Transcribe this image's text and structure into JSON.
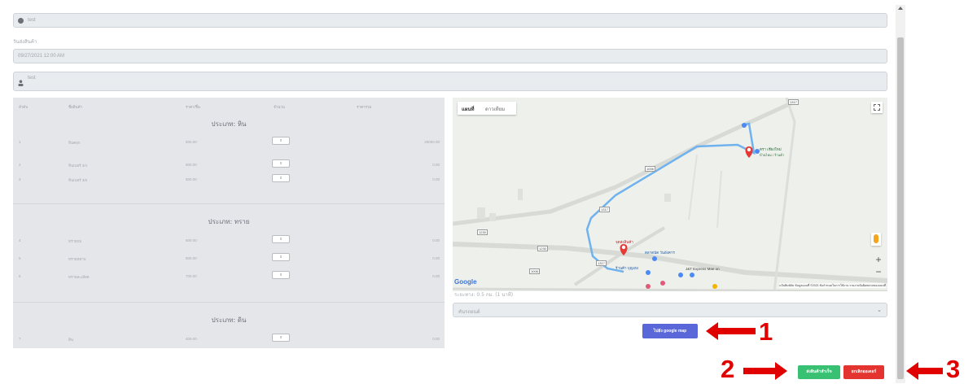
{
  "form": {
    "name_placeholder": "test",
    "date_label": "วันส่งสินค้า",
    "date_value": "09/27/2021 12:00 AM",
    "user_placeholder": "test"
  },
  "table": {
    "headers": [
      "ลำดับ",
      "ชื่อสินค้า",
      "ราคา/ชิ้น",
      "จำนวน",
      "ราคารวม"
    ],
    "sections": [
      {
        "title": "ประเภท: หิน",
        "rows": [
          {
            "no": "1",
            "name": "หินคลุก",
            "price": "500.00",
            "qty": "0",
            "total": "25000.00"
          },
          {
            "no": "2",
            "name": "หินเบอร์ 3/4",
            "price": "600.00",
            "qty": "0",
            "total": "0.00"
          },
          {
            "no": "3",
            "name": "หินเบอร์ 3/8",
            "price": "500.00",
            "qty": "0",
            "total": "0.00"
          }
        ]
      },
      {
        "title": "ประเภท: ทราย",
        "rows": [
          {
            "no": "4",
            "name": "ทรายถม",
            "price": "600.00",
            "qty": "0",
            "total": "0.00"
          },
          {
            "no": "5",
            "name": "ทรายหยาบ",
            "price": "500.00",
            "qty": "0",
            "total": "0.00"
          },
          {
            "no": "6",
            "name": "ทรายละเอียด",
            "price": "700.00",
            "qty": "0",
            "total": "0.00"
          }
        ]
      },
      {
        "title": "ประเภท: ดิน",
        "rows": [
          {
            "no": "7",
            "name": "ดิน",
            "price": "400.00",
            "qty": "0",
            "total": "0.00"
          }
        ]
      }
    ]
  },
  "map": {
    "tab_map": "แผนที่",
    "tab_satellite": "ดาวเทียม",
    "label_a": "ตรา เชียงใหม่",
    "label_a2": "บ้านไหม / ร้านค้า",
    "label_b": "จุดส่งสินค้า",
    "place_1": "ตลาดนัด วันอังคาร",
    "place_2": "J&T Express Mae on",
    "place_3": "ร้านค้า บุญเฮง",
    "road_1": "1317",
    "road_2": "1006",
    "road_3": "1317",
    "road_4": "1230",
    "road_5": "1230",
    "road_6": "1006",
    "road_7": "1317",
    "google": "Google",
    "attribution": "แป้นพิมพ์ลัด   ข้อมูลแผนที่ ©2021   ข้อกำหนดในการใช้งาน   รายงานข้อผิดพลาดของแผนที่",
    "distance": "ระยะทาง: 0.5 กม. (1 นาที)"
  },
  "select_placeholder": "คันรถยนต์",
  "buttons": {
    "google_map": "ไปยัง google map",
    "confirm": "ส่งสินค้าสำเร็จ",
    "cancel": "ยกเลิกออเดอร์"
  },
  "annotations": {
    "n1": "1",
    "n2": "2",
    "n3": "3"
  },
  "colors": {
    "google_btn": "#5a67d8",
    "confirm_btn": "#38c172",
    "cancel_btn": "#e3342f",
    "arrow": "#e00000",
    "route": "#6fb2ee"
  }
}
